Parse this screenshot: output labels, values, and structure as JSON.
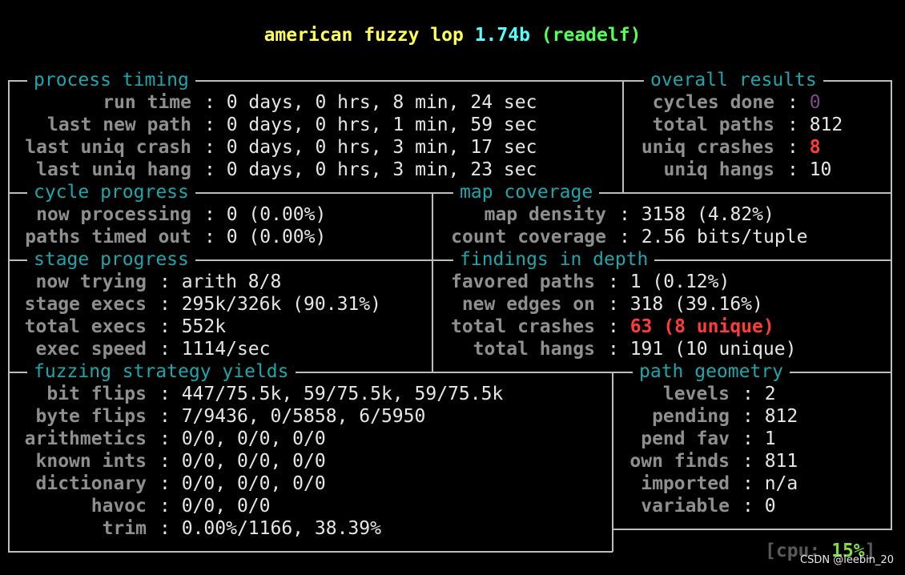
{
  "title": {
    "prefix": "american fuzzy lop ",
    "version": "1.74b",
    "target": "(readelf)"
  },
  "sections": {
    "process_timing": "process timing",
    "overall_results": "overall results",
    "cycle_progress": "cycle progress",
    "map_coverage": "map coverage",
    "stage_progress": "stage progress",
    "findings_in_depth": "findings in depth",
    "fuzzing_strategy_yields": "fuzzing strategy yields",
    "path_geometry": "path geometry"
  },
  "process_timing": [
    {
      "label": "run time",
      "value": "0 days, 0 hrs, 8 min, 24 sec"
    },
    {
      "label": "last new path",
      "value": "0 days, 0 hrs, 1 min, 59 sec"
    },
    {
      "label": "last uniq crash",
      "value": "0 days, 0 hrs, 3 min, 17 sec"
    },
    {
      "label": "last uniq hang",
      "value": "0 days, 0 hrs, 3 min, 23 sec"
    }
  ],
  "overall_results": [
    {
      "label": "cycles done",
      "value": "0"
    },
    {
      "label": "total paths",
      "value": "812"
    },
    {
      "label": "uniq crashes",
      "value": "8"
    },
    {
      "label": "uniq hangs",
      "value": "10"
    }
  ],
  "cycle_progress": [
    {
      "label": "now processing",
      "value": "0 (0.00%)"
    },
    {
      "label": "paths timed out",
      "value": "0 (0.00%)"
    }
  ],
  "map_coverage": [
    {
      "label": "map density",
      "value": "3158 (4.82%)"
    },
    {
      "label": "count coverage",
      "value": "2.56 bits/tuple"
    }
  ],
  "stage_progress": [
    {
      "label": "now trying",
      "value": "arith 8/8"
    },
    {
      "label": "stage execs",
      "value": "295k/326k (90.31%)"
    },
    {
      "label": "total execs",
      "value": "552k"
    },
    {
      "label": "exec speed",
      "value": "1114/sec"
    }
  ],
  "findings_in_depth": [
    {
      "label": "favored paths",
      "value": "1 (0.12%)"
    },
    {
      "label": "new edges on",
      "value": "318 (39.16%)"
    },
    {
      "label": "total crashes",
      "value": "63 (8 unique)"
    },
    {
      "label": "total hangs",
      "value": "191 (10 unique)"
    }
  ],
  "fuzzing_strategy_yields": [
    {
      "label": "bit flips",
      "value": "447/75.5k, 59/75.5k, 59/75.5k"
    },
    {
      "label": "byte flips",
      "value": "7/9436, 0/5858, 6/5950"
    },
    {
      "label": "arithmetics",
      "value": "0/0, 0/0, 0/0"
    },
    {
      "label": "known ints",
      "value": "0/0, 0/0, 0/0"
    },
    {
      "label": "dictionary",
      "value": "0/0, 0/0, 0/0"
    },
    {
      "label": "havoc",
      "value": "0/0, 0/0"
    },
    {
      "label": "trim",
      "value": "0.00%/1166, 38.39%"
    }
  ],
  "path_geometry": [
    {
      "label": "levels",
      "value": "2"
    },
    {
      "label": "pending",
      "value": "812"
    },
    {
      "label": "pend fav",
      "value": "1"
    },
    {
      "label": "own finds",
      "value": "811"
    },
    {
      "label": "imported",
      "value": "n/a"
    },
    {
      "label": "variable",
      "value": "0"
    }
  ],
  "cpu": {
    "label": "[cpu:",
    "value": "15%",
    "close": "]"
  },
  "watermark": "CSDN @leebin_20",
  "colors": {
    "title_yellow": "#ffff55",
    "title_cyan": "#55ffff",
    "title_green": "#55ff55",
    "section": "#19a8ad",
    "label": "#8f8f8f",
    "crash_red": "#ff3b3b",
    "cpu_green": "#7fdc3a"
  }
}
